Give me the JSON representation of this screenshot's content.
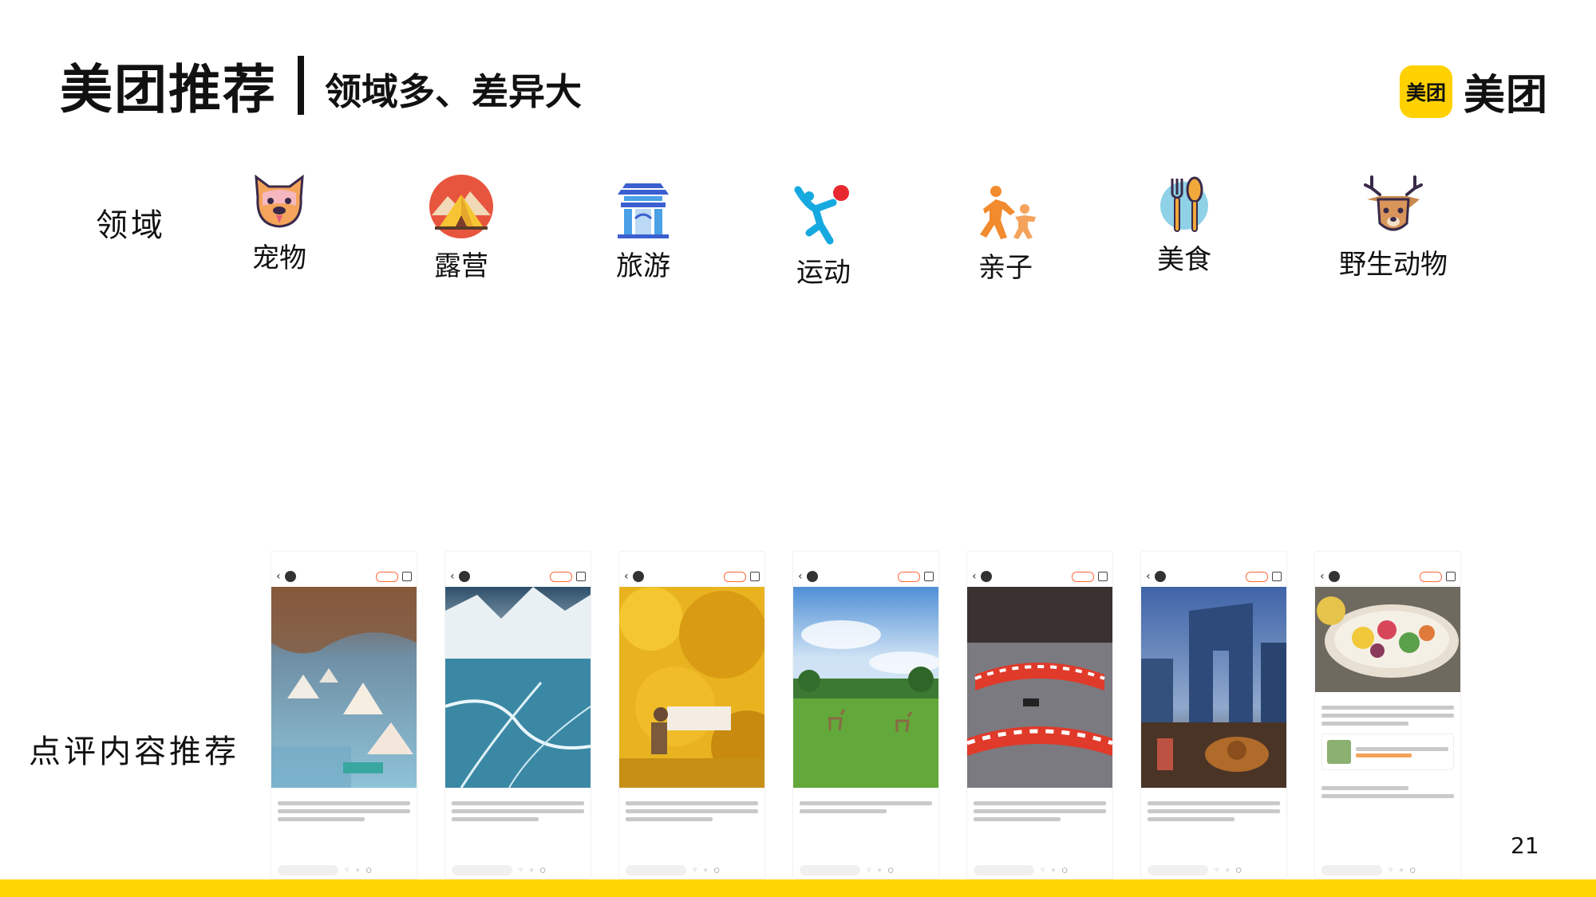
{
  "title": {
    "main": "美团推荐",
    "sub": "领域多、差异大"
  },
  "logo": {
    "badge_text": "美团",
    "text": "美团",
    "color": "#ffd100",
    "icon": "meituan-logo-icon"
  },
  "domain_section": {
    "label": "领域",
    "items": [
      {
        "name": "宠物",
        "icon": "pet-icon"
      },
      {
        "name": "露营",
        "icon": "camping-icon"
      },
      {
        "name": "旅游",
        "icon": "travel-gate-icon"
      },
      {
        "name": "运动",
        "icon": "sport-figure-icon"
      },
      {
        "name": "亲子",
        "icon": "parent-child-icon"
      },
      {
        "name": "美食",
        "icon": "food-utensils-icon"
      },
      {
        "name": "野生动物",
        "icon": "deer-icon"
      }
    ]
  },
  "content_section": {
    "label": "点评内容推荐",
    "posts": [
      {
        "theme": "ice-camping"
      },
      {
        "theme": "frozen-lake"
      },
      {
        "theme": "ginkgo-tea"
      },
      {
        "theme": "deer-meadow"
      },
      {
        "theme": "go-kart"
      },
      {
        "theme": "city-food"
      },
      {
        "theme": "salad-bowl"
      }
    ]
  },
  "page_number": "21",
  "accent_color": "#ffd400"
}
